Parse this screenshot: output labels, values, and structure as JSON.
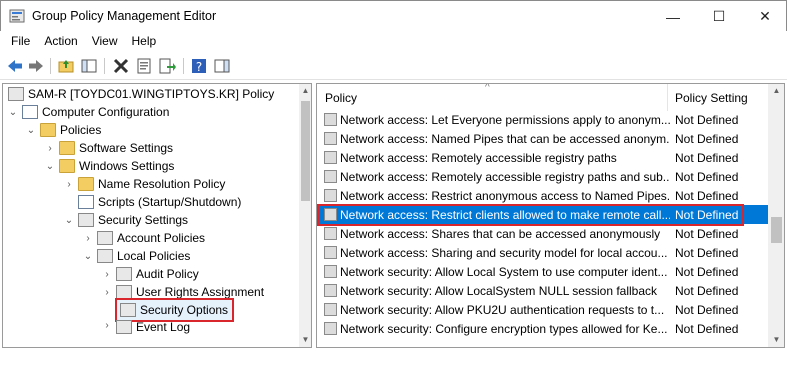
{
  "window": {
    "title": "Group Policy Management Editor",
    "minimize_glyph": "—",
    "maximize_glyph": "☐",
    "close_glyph": "✕"
  },
  "menu": [
    "File",
    "Action",
    "View",
    "Help"
  ],
  "toolbar": {
    "icons": [
      "back-icon",
      "forward-icon",
      "up-folder-icon",
      "show-hide-tree-icon",
      "delete-icon",
      "properties-icon",
      "export-list-icon",
      "help-icon",
      "show-action-pane-icon"
    ]
  },
  "tree": [
    {
      "label": "SAM-R [TOYDC01.WINGTIPTOYS.KR] Policy",
      "expander": "",
      "icon": "policy-icon"
    },
    {
      "label": "Computer Configuration",
      "expander": "⌄",
      "icon": "computer-icon"
    },
    {
      "label": "Policies",
      "expander": "⌄",
      "icon": "folder-icon"
    },
    {
      "label": "Software Settings",
      "expander": "›",
      "icon": "folder-icon"
    },
    {
      "label": "Windows Settings",
      "expander": "⌄",
      "icon": "folder-icon"
    },
    {
      "label": "Name Resolution Policy",
      "expander": "›",
      "icon": "folder-icon"
    },
    {
      "label": "Scripts (Startup/Shutdown)",
      "expander": "",
      "icon": "script-icon"
    },
    {
      "label": "Security Settings",
      "expander": "⌄",
      "icon": "security-icon"
    },
    {
      "label": "Account Policies",
      "expander": "›",
      "icon": "security-icon"
    },
    {
      "label": "Local Policies",
      "expander": "⌄",
      "icon": "security-icon"
    },
    {
      "label": "Audit Policy",
      "expander": "›",
      "icon": "security-icon"
    },
    {
      "label": "User Rights Assignment",
      "expander": "›",
      "icon": "security-icon"
    },
    {
      "label": "Security Options",
      "expander": "",
      "icon": "security-icon"
    },
    {
      "label": "Event Log",
      "expander": "›",
      "icon": "security-icon"
    }
  ],
  "list": {
    "col_policy": "Policy",
    "col_setting": "Policy Setting",
    "rows": [
      {
        "policy": "Network access: Let Everyone permissions apply to anonym...",
        "setting": "Not Defined"
      },
      {
        "policy": "Network access: Named Pipes that can be accessed anonym...",
        "setting": "Not Defined"
      },
      {
        "policy": "Network access: Remotely accessible registry paths",
        "setting": "Not Defined"
      },
      {
        "policy": "Network access: Remotely accessible registry paths and sub...",
        "setting": "Not Defined"
      },
      {
        "policy": "Network access: Restrict anonymous access to Named Pipes...",
        "setting": "Not Defined"
      },
      {
        "policy": "Network access: Restrict clients allowed to make remote call...",
        "setting": "Not Defined"
      },
      {
        "policy": "Network access: Shares that can be accessed anonymously",
        "setting": "Not Defined"
      },
      {
        "policy": "Network access: Sharing and security model for local accou...",
        "setting": "Not Defined"
      },
      {
        "policy": "Network security: Allow Local System to use computer ident...",
        "setting": "Not Defined"
      },
      {
        "policy": "Network security: Allow LocalSystem NULL session fallback",
        "setting": "Not Defined"
      },
      {
        "policy": "Network security: Allow PKU2U authentication requests to t...",
        "setting": "Not Defined"
      },
      {
        "policy": "Network security: Configure encryption types allowed for Ke...",
        "setting": "Not Defined"
      }
    ]
  },
  "colors": {
    "selection": "#0078d7",
    "highlight_outline": "#d9262c"
  }
}
